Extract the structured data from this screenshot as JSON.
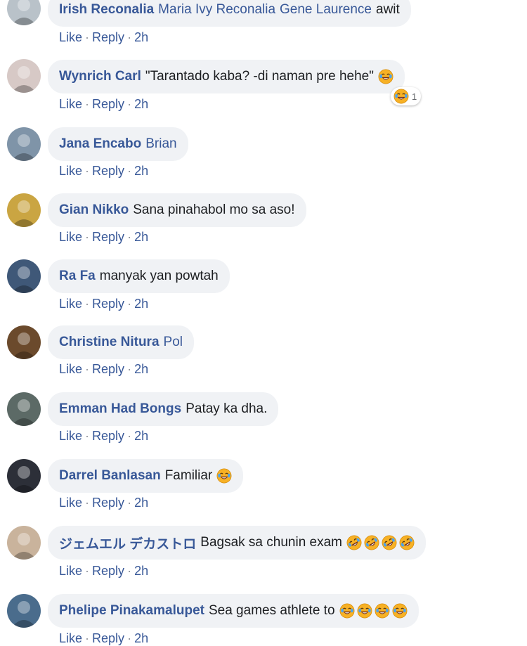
{
  "actions": {
    "like": "Like",
    "reply": "Reply",
    "separator": "·"
  },
  "colors": {
    "link": "#385898",
    "bubble": "#f0f2f5",
    "text": "#1c1e21"
  },
  "comments": [
    {
      "author": "Irish Reconalia",
      "tags": [
        "Maria Ivy Reconalia",
        "Gene Laurence"
      ],
      "text": "awit",
      "emojis": [],
      "time": "2h",
      "avatar_color": "#b9c2c9"
    },
    {
      "author": "Wynrich Carl",
      "tags": [],
      "text": "\"Tarantado kaba? -di naman pre hehe\"",
      "emojis": [
        "laugh"
      ],
      "time": "2h",
      "reaction": {
        "icon": "haha-reaction",
        "count": "1"
      },
      "avatar_color": "#d7c9c6"
    },
    {
      "author": "Jana Encabo",
      "tags": [
        "Brian"
      ],
      "text": "",
      "emojis": [],
      "time": "2h",
      "avatar_color": "#7f94a8"
    },
    {
      "author": "Gian Nikko",
      "tags": [],
      "text": "Sana pinahabol mo sa aso!",
      "emojis": [],
      "time": "2h",
      "avatar_color": "#caa542"
    },
    {
      "author": "Ra Fa",
      "tags": [],
      "text": "manyak yan powtah",
      "emojis": [],
      "time": "2h",
      "avatar_color": "#3f5878"
    },
    {
      "author": "Christine Nitura",
      "tags": [
        "Pol"
      ],
      "text": "",
      "emojis": [],
      "time": "2h",
      "avatar_color": "#6b4a2c"
    },
    {
      "author": "Emman Had Bongs",
      "tags": [],
      "text": "Patay ka dha.",
      "emojis": [],
      "time": "2h",
      "avatar_color": "#5c6a66"
    },
    {
      "author": "Darrel Banlasan",
      "tags": [],
      "text": "Familiar",
      "emojis": [
        "laugh"
      ],
      "time": "2h",
      "avatar_color": "#2c2f38"
    },
    {
      "author": "ジェムエル デカストロ",
      "tags": [],
      "text": "Bagsak sa chunin exam",
      "emojis": [
        "rofl",
        "rofl",
        "rofl",
        "rofl"
      ],
      "time": "2h",
      "avatar_color": "#c9b39c"
    },
    {
      "author": "Phelipe Pinakamalupet",
      "tags": [],
      "text": "Sea games athlete to",
      "emojis": [
        "laugh",
        "laugh",
        "laugh",
        "laugh"
      ],
      "time": "2h",
      "avatar_color": "#4a6c8c"
    }
  ]
}
